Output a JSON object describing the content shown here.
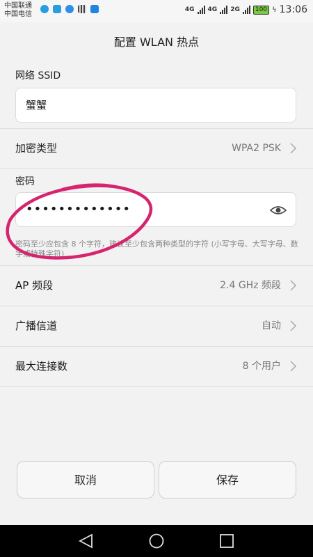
{
  "status": {
    "carrier1": "中国联通",
    "carrier2": "中国电信",
    "net1": "4G",
    "net2": "4G",
    "net3": "2G",
    "battery": "100",
    "time": "13:06"
  },
  "header": {
    "title": "配置 WLAN 热点"
  },
  "ssid": {
    "label": "网络 SSID",
    "value": "蟹蟹"
  },
  "encryption": {
    "label": "加密类型",
    "value": "WPA2 PSK"
  },
  "password": {
    "label": "密码",
    "value": "•••••••••••••",
    "hint": "密码至少应包含 8 个字符，建议至少包含两种类型的字符 (小写字母、大写字母、数字或特殊字符)"
  },
  "ap_band": {
    "label": "AP 频段",
    "value": "2.4 GHz 频段"
  },
  "channel": {
    "label": "广播信道",
    "value": "自动"
  },
  "max_conn": {
    "label": "最大连接数",
    "value": "8 个用户"
  },
  "buttons": {
    "cancel": "取消",
    "save": "保存"
  },
  "colors": {
    "annotation": "#d6246e",
    "battery": "#7ac943"
  }
}
